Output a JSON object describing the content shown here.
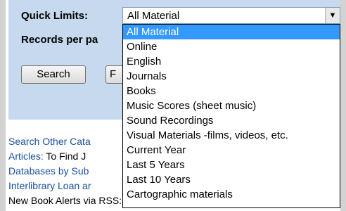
{
  "form": {
    "quick_limits_label": "Quick Limits:",
    "records_label": "Records per pa",
    "search_button": "Search",
    "second_button": "F"
  },
  "select": {
    "value": "All Material",
    "arrow": "▼",
    "options": [
      {
        "label": "All Material",
        "selected": true
      },
      {
        "label": "Online"
      },
      {
        "label": "English"
      },
      {
        "label": "Journals"
      },
      {
        "label": "Books"
      },
      {
        "label": "Music Scores (sheet music)"
      },
      {
        "label": "Sound Recordings"
      },
      {
        "label": "Visual Materials -films, videos, etc."
      },
      {
        "label": "Current Year"
      },
      {
        "label": "Last 5 Years"
      },
      {
        "label": "Last 10 Years"
      },
      {
        "label": "Cartographic materials"
      }
    ]
  },
  "links": {
    "search_other": "Search Other Cata",
    "articles": "Articles:",
    "articles_text": " To Find J",
    "databases": "Databases by Sub",
    "interlibrary": "Interlibrary Loan ar",
    "new_book_alerts": "New Book Alerts via RSS: Try RSS New Books"
  },
  "colors": {
    "panel": "#c7d9ef",
    "link": "#1a4fa0",
    "selected": "#3399ff"
  }
}
